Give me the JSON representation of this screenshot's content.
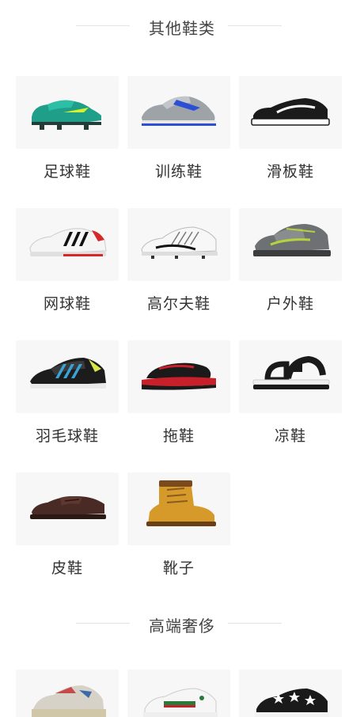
{
  "sections": {
    "other_shoes": {
      "title": "其他鞋类",
      "items": [
        {
          "label": "足球鞋",
          "icon": "soccer-cleat-icon"
        },
        {
          "label": "训练鞋",
          "icon": "training-shoe-icon"
        },
        {
          "label": "滑板鞋",
          "icon": "skate-shoe-icon"
        },
        {
          "label": "网球鞋",
          "icon": "tennis-shoe-icon"
        },
        {
          "label": "高尔夫鞋",
          "icon": "golf-shoe-icon"
        },
        {
          "label": "户外鞋",
          "icon": "outdoor-shoe-icon"
        },
        {
          "label": "羽毛球鞋",
          "icon": "badminton-shoe-icon"
        },
        {
          "label": "拖鞋",
          "icon": "slipper-icon"
        },
        {
          "label": "凉鞋",
          "icon": "sandal-icon"
        },
        {
          "label": "皮鞋",
          "icon": "leather-shoe-icon"
        },
        {
          "label": "靴子",
          "icon": "boot-icon"
        }
      ]
    },
    "luxury": {
      "title": "高端奢侈",
      "items": [
        {
          "icon": "chunky-sneaker-icon"
        },
        {
          "icon": "designer-sneaker-icon"
        },
        {
          "icon": "star-sneaker-icon"
        }
      ]
    }
  },
  "colors": {
    "divider": "#e3e3e3",
    "text": "#333333",
    "background": "#ffffff"
  }
}
